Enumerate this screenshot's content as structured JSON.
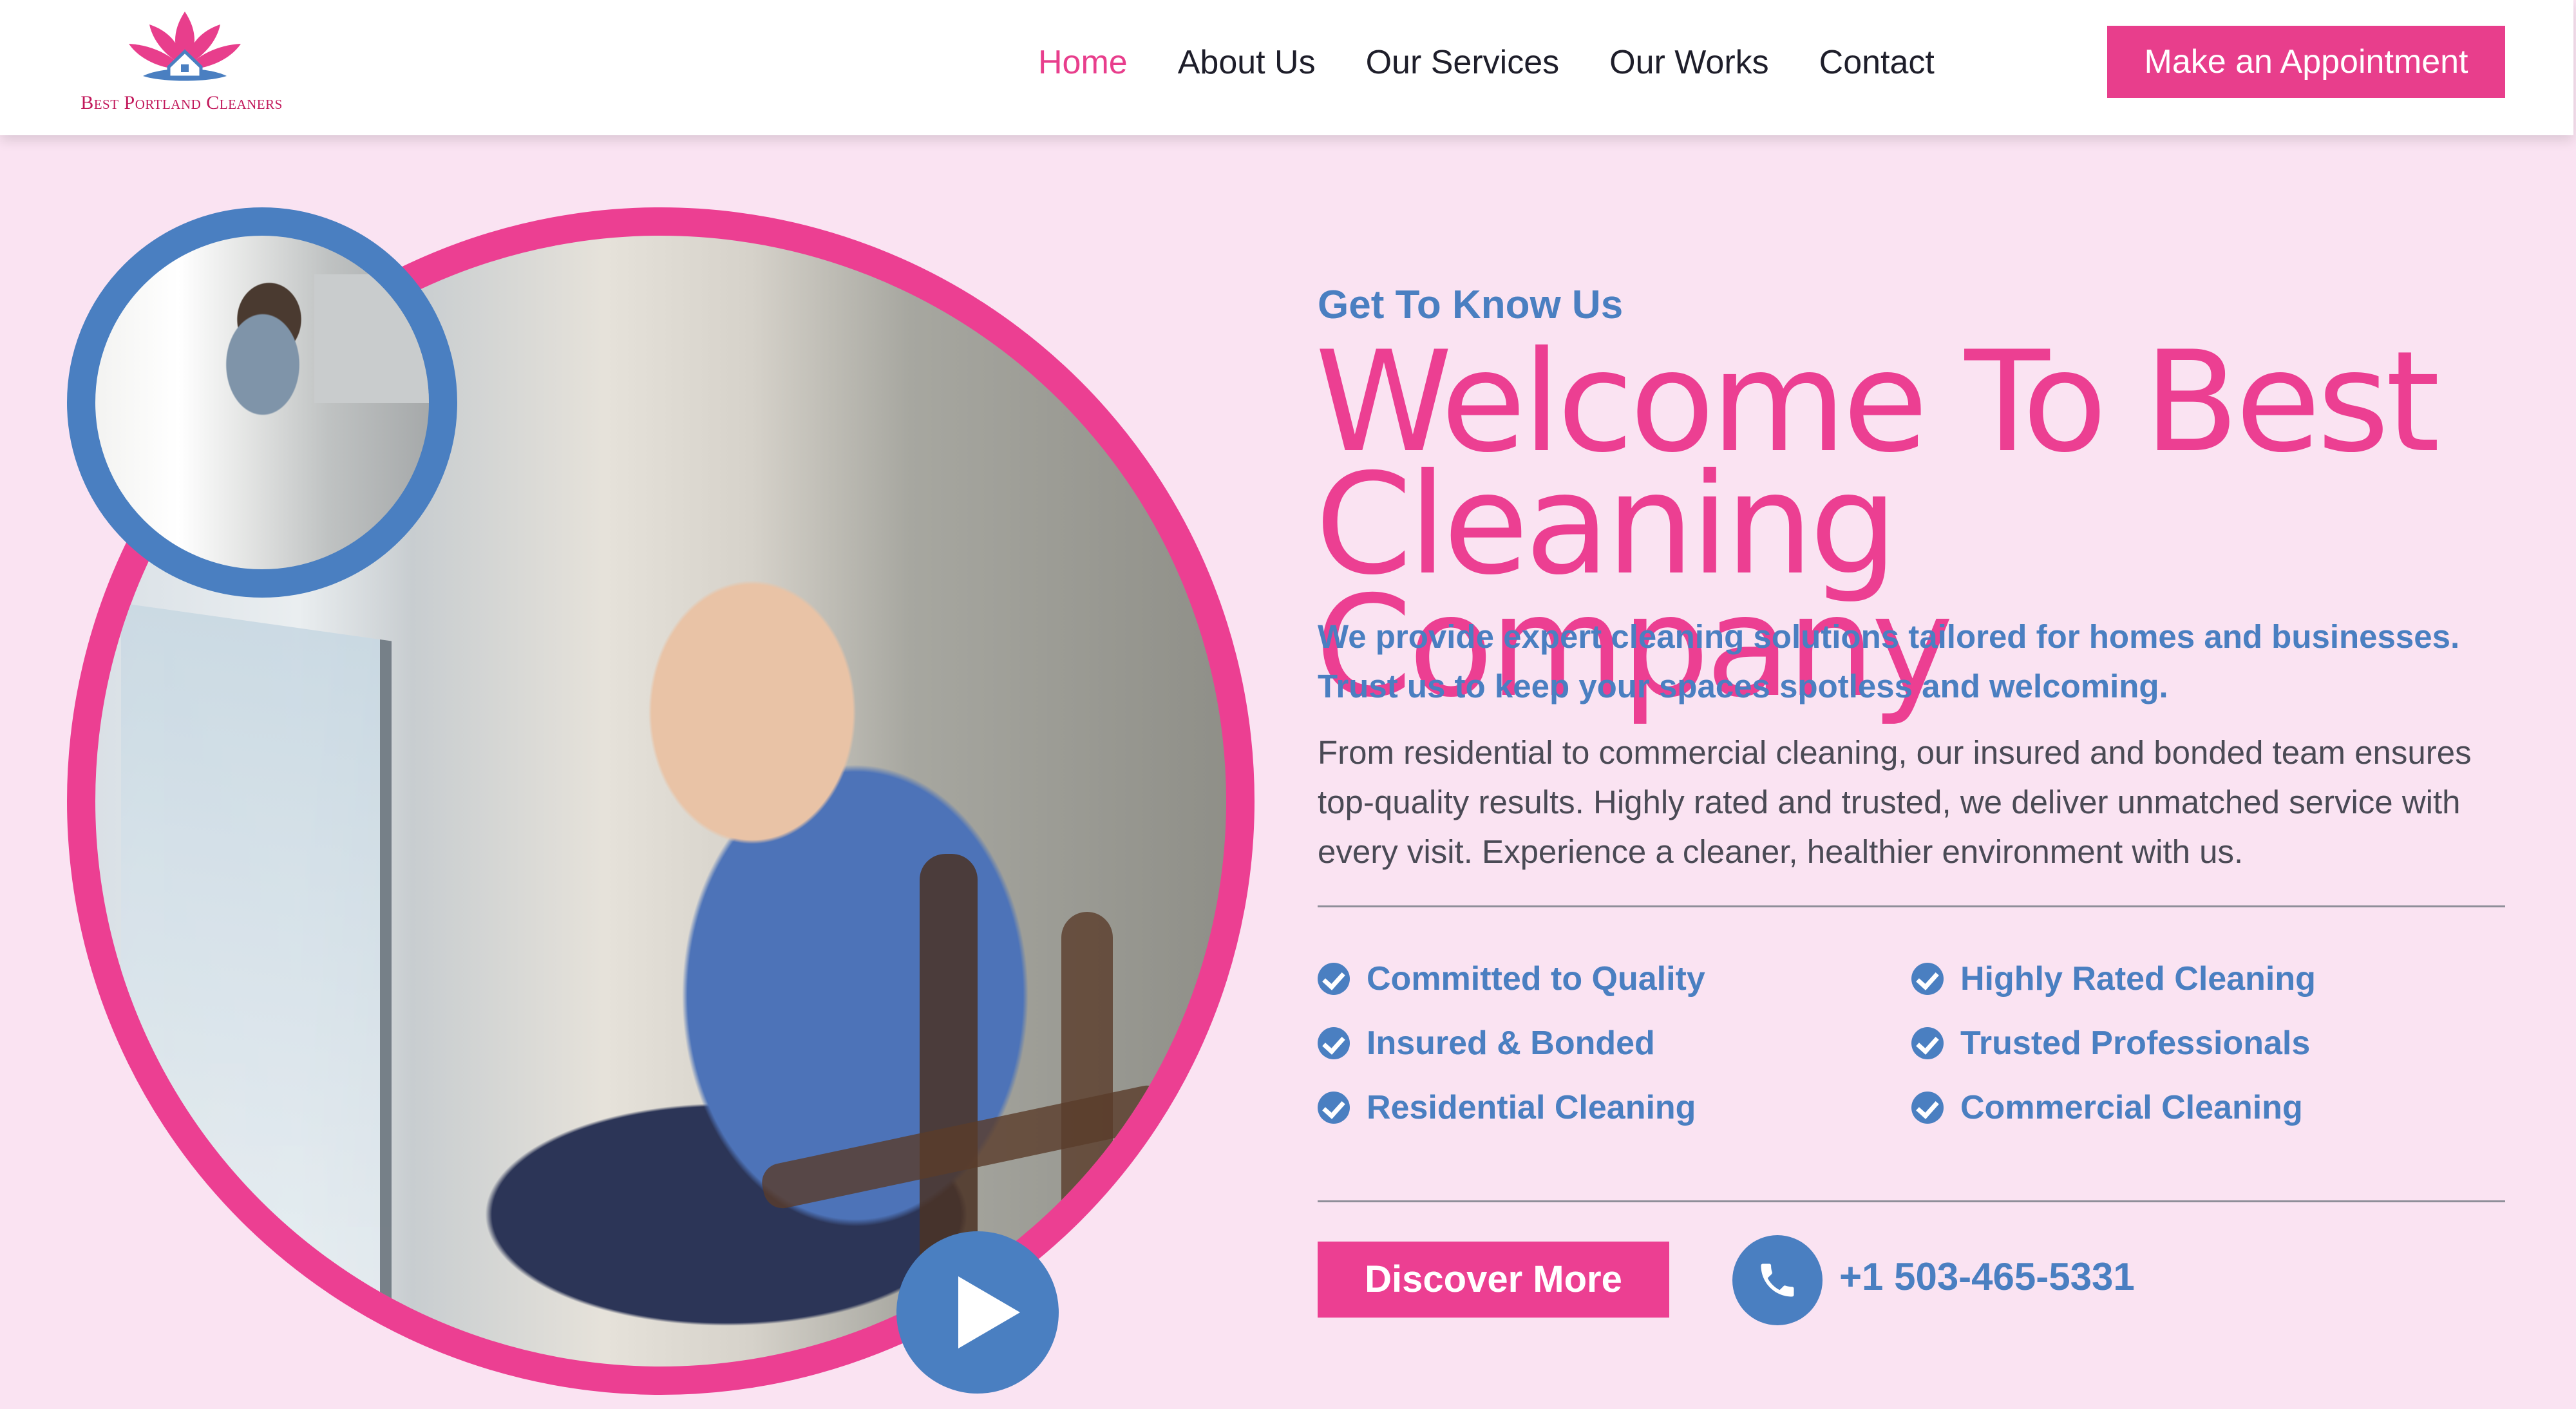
{
  "header": {
    "logo_text": "Best Portland Cleaners",
    "nav": [
      "Home",
      "About Us",
      "Our Services",
      "Our Works",
      "Contact"
    ],
    "active_nav": "Home",
    "cta_label": "Make an Appointment"
  },
  "hero": {
    "eyebrow": "Get To Know Us",
    "title_line1": "Welcome To Best",
    "title_line2": "Cleaning Company",
    "lead": "We provide expert cleaning solutions tailored for homes and businesses. Trust us to keep your spaces spotless and welcoming.",
    "body": "From residential to commercial cleaning, our insured and bonded team ensures top-quality results. Highly rated and trusted, we deliver unmatched service with every visit. Experience a cleaner, healthier environment with us.",
    "features": [
      "Committed to Quality",
      "Highly Rated Cleaning",
      "Insured & Bonded",
      "Trusted Professionals",
      "Residential Cleaning",
      "Commercial Cleaning"
    ],
    "discover_label": "Discover More",
    "phone": "+1 503-465-5331"
  },
  "colors": {
    "pink": "#ec3f92",
    "blue": "#4a7fc1",
    "background": "#fae3f2"
  },
  "icons": [
    "lotus-house-logo-icon",
    "play-icon",
    "check-circle-icon",
    "phone-icon"
  ]
}
